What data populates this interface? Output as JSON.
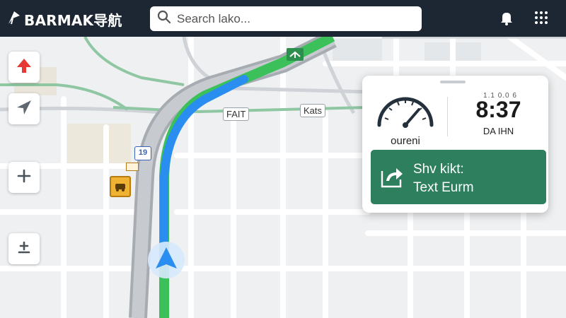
{
  "app": {
    "title": "BARMAK导航"
  },
  "search": {
    "placeholder": "Search lako..."
  },
  "header": {
    "notifications_icon": "bell-icon",
    "apps_icon": "grid-icon"
  },
  "map_controls": [
    {
      "icon": "compass-arrow-icon"
    },
    {
      "icon": "navigate-icon"
    },
    {
      "icon": "zoom-in-icon"
    },
    {
      "icon": "zoom-out-icon"
    }
  ],
  "map_labels": {
    "road_label_1": "FAIT",
    "road_label_2": "Kats",
    "route_shield": "19"
  },
  "info_card": {
    "speed_label": "oureni",
    "eta_small": "1.1 0.0 6",
    "eta_time": "8:37",
    "eta_sub": "DA IHN",
    "next_turn": {
      "title": "Shv kikt:",
      "detail": "Text Eurm"
    }
  },
  "colors": {
    "topbar": "#1d2733",
    "route_blue": "#2a8ef0",
    "route_green": "#3cc15a",
    "card_green": "#2d7f5e",
    "arrow_red": "#e53935"
  }
}
